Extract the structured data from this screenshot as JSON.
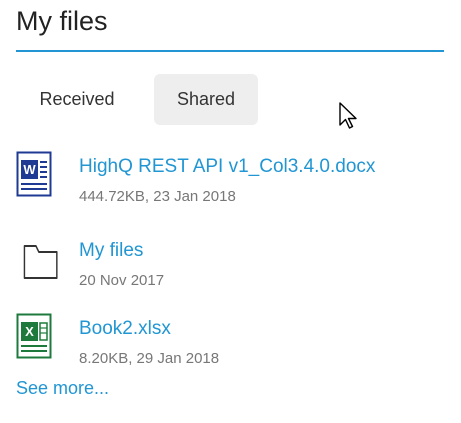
{
  "page": {
    "title": "My files"
  },
  "tabs": [
    {
      "label": "Received",
      "selected": false
    },
    {
      "label": "Shared",
      "selected": true
    }
  ],
  "files": [
    {
      "icon": "word-document-icon",
      "name": "HighQ REST API v1_Col3.4.0.docx",
      "meta": "444.72KB, 23 Jan 2018"
    },
    {
      "icon": "folder-icon",
      "name": "My files",
      "meta": "20 Nov 2017"
    },
    {
      "icon": "excel-spreadsheet-icon",
      "name": "Book2.xlsx",
      "meta": "8.20KB, 29 Jan 2018"
    }
  ],
  "see_more": {
    "label": "See more..."
  },
  "colors": {
    "accent": "#2196d3",
    "word": "#1f3a93",
    "excel": "#1e7a3c",
    "tab_selected_bg": "#eeeeee"
  }
}
